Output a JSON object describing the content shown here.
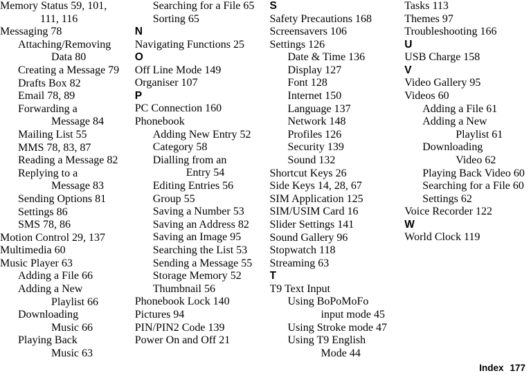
{
  "page": {
    "type": "index",
    "footer": {
      "label": "Index",
      "page_number": "177"
    },
    "text_color": "#000000",
    "background_color": "#ffffff"
  },
  "columns": [
    {
      "id": "column-1",
      "blocks": [
        {
          "kind": "entry",
          "level": 1,
          "text": "Memory Status 59, 101,"
        },
        {
          "kind": "entry",
          "level": 3,
          "text": "111, 116"
        },
        {
          "kind": "entry",
          "level": 1,
          "text": "Messaging 78"
        },
        {
          "kind": "entry",
          "level": 2,
          "text": "Attaching/Removing"
        },
        {
          "kind": "entry",
          "level": 4,
          "text": "Data 80"
        },
        {
          "kind": "entry",
          "level": 2,
          "text": "Creating a Message 79"
        },
        {
          "kind": "entry",
          "level": 2,
          "text": "Drafts Box 82"
        },
        {
          "kind": "entry",
          "level": 2,
          "text": "Email 78, 89"
        },
        {
          "kind": "entry",
          "level": 2,
          "text": "Forwarding a"
        },
        {
          "kind": "entry",
          "level": 4,
          "text": "Message 84"
        },
        {
          "kind": "entry",
          "level": 2,
          "text": "Mailing List 55"
        },
        {
          "kind": "entry",
          "level": 2,
          "text": "MMS 78, 83, 87"
        },
        {
          "kind": "entry",
          "level": 2,
          "text": "Reading a Message 82"
        },
        {
          "kind": "entry",
          "level": 2,
          "text": "Replying to a"
        },
        {
          "kind": "entry",
          "level": 4,
          "text": "Message 83"
        },
        {
          "kind": "entry",
          "level": 2,
          "text": "Sending Options 81"
        },
        {
          "kind": "entry",
          "level": 2,
          "text": "Settings 86"
        },
        {
          "kind": "entry",
          "level": 2,
          "text": "SMS 78, 86"
        },
        {
          "kind": "entry",
          "level": 1,
          "text": "Motion Control 29, 137"
        },
        {
          "kind": "entry",
          "level": 1,
          "text": "Multimedia 60"
        },
        {
          "kind": "entry",
          "level": 1,
          "text": "Music Player 63"
        },
        {
          "kind": "entry",
          "level": 2,
          "text": "Adding a File 66"
        },
        {
          "kind": "entry",
          "level": 2,
          "text": "Adding a New"
        },
        {
          "kind": "entry",
          "level": 4,
          "text": "Playlist 66"
        },
        {
          "kind": "entry",
          "level": 2,
          "text": "Downloading"
        },
        {
          "kind": "entry",
          "level": 4,
          "text": "Music 66"
        },
        {
          "kind": "entry",
          "level": 2,
          "text": "Playing Back"
        },
        {
          "kind": "entry",
          "level": 4,
          "text": "Music 63"
        }
      ]
    },
    {
      "id": "column-2",
      "blocks": [
        {
          "kind": "entry",
          "level": 2,
          "text": "Searching for a File 65"
        },
        {
          "kind": "entry",
          "level": 2,
          "text": "Sorting 65"
        },
        {
          "kind": "letter",
          "text": "N"
        },
        {
          "kind": "entry",
          "level": 1,
          "text": "Navigating Functions 25"
        },
        {
          "kind": "letter",
          "text": "O"
        },
        {
          "kind": "entry",
          "level": 1,
          "text": "Off Line Mode 149"
        },
        {
          "kind": "entry",
          "level": 1,
          "text": "Organiser 107"
        },
        {
          "kind": "letter",
          "text": "P"
        },
        {
          "kind": "entry",
          "level": 1,
          "text": "PC Connection 160"
        },
        {
          "kind": "entry",
          "level": 1,
          "text": "Phonebook"
        },
        {
          "kind": "entry",
          "level": 2,
          "text": "Adding New Entry 52"
        },
        {
          "kind": "entry",
          "level": 2,
          "text": "Category 58"
        },
        {
          "kind": "entry",
          "level": 2,
          "text": "Dialling from an"
        },
        {
          "kind": "entry",
          "level": 4,
          "text": "Entry 54"
        },
        {
          "kind": "entry",
          "level": 2,
          "text": "Editing Entries 56"
        },
        {
          "kind": "entry",
          "level": 2,
          "text": "Group 55"
        },
        {
          "kind": "entry",
          "level": 2,
          "text": "Saving a Number 53"
        },
        {
          "kind": "entry",
          "level": 2,
          "text": "Saving an Address 82"
        },
        {
          "kind": "entry",
          "level": 2,
          "text": "Saving an Image 95"
        },
        {
          "kind": "entry",
          "level": 2,
          "text": "Searching the List 53"
        },
        {
          "kind": "entry",
          "level": 2,
          "text": "Sending a Message 55"
        },
        {
          "kind": "entry",
          "level": 2,
          "text": "Storage Memory 52"
        },
        {
          "kind": "entry",
          "level": 2,
          "text": "Thumbnail 56"
        },
        {
          "kind": "entry",
          "level": 1,
          "text": "Phonebook Lock 140"
        },
        {
          "kind": "entry",
          "level": 1,
          "text": "Pictures 94"
        },
        {
          "kind": "entry",
          "level": 1,
          "text": "PIN/PIN2 Code 139"
        },
        {
          "kind": "entry",
          "level": 1,
          "text": "Power On and Off 21"
        }
      ]
    },
    {
      "id": "column-3",
      "blocks": [
        {
          "kind": "letter",
          "text": "S"
        },
        {
          "kind": "entry",
          "level": 1,
          "text": "Safety Precautions 168"
        },
        {
          "kind": "entry",
          "level": 1,
          "text": "Screensavers 106"
        },
        {
          "kind": "entry",
          "level": 1,
          "text": "Settings 126"
        },
        {
          "kind": "entry",
          "level": 2,
          "text": "Date & Time 136"
        },
        {
          "kind": "entry",
          "level": 2,
          "text": "Display 127"
        },
        {
          "kind": "entry",
          "level": 2,
          "text": "Font 128"
        },
        {
          "kind": "entry",
          "level": 2,
          "text": "Internet 150"
        },
        {
          "kind": "entry",
          "level": 2,
          "text": "Language 137"
        },
        {
          "kind": "entry",
          "level": 2,
          "text": "Network 148"
        },
        {
          "kind": "entry",
          "level": 2,
          "text": "Profiles 126"
        },
        {
          "kind": "entry",
          "level": 2,
          "text": "Security 139"
        },
        {
          "kind": "entry",
          "level": 2,
          "text": "Sound 132"
        },
        {
          "kind": "entry",
          "level": 1,
          "text": "Shortcut Keys 26"
        },
        {
          "kind": "entry",
          "level": 1,
          "text": "Side Keys 14, 28, 67"
        },
        {
          "kind": "entry",
          "level": 1,
          "text": "SIM Application 125"
        },
        {
          "kind": "entry",
          "level": 1,
          "text": "SIM/USIM Card 16"
        },
        {
          "kind": "entry",
          "level": 1,
          "text": "Slider Settings 141"
        },
        {
          "kind": "entry",
          "level": 1,
          "text": "Sound Gallery 96"
        },
        {
          "kind": "entry",
          "level": 1,
          "text": "Stopwatch 118"
        },
        {
          "kind": "entry",
          "level": 1,
          "text": "Streaming 63"
        },
        {
          "kind": "letter",
          "text": "T"
        },
        {
          "kind": "entry",
          "level": 1,
          "text": "T9 Text Input"
        },
        {
          "kind": "entry",
          "level": 2,
          "text": "Using BoPoMoFo"
        },
        {
          "kind": "entry",
          "level": 4,
          "text": "input mode 45"
        },
        {
          "kind": "entry",
          "level": 2,
          "text": "Using Stroke mode 47"
        },
        {
          "kind": "entry",
          "level": 2,
          "text": "Using T9 English"
        },
        {
          "kind": "entry",
          "level": 4,
          "text": "Mode 44"
        }
      ]
    },
    {
      "id": "column-4",
      "blocks": [
        {
          "kind": "entry",
          "level": 1,
          "text": "Tasks 113"
        },
        {
          "kind": "entry",
          "level": 1,
          "text": "Themes 97"
        },
        {
          "kind": "entry",
          "level": 1,
          "text": "Troubleshooting 166"
        },
        {
          "kind": "letter",
          "text": "U"
        },
        {
          "kind": "entry",
          "level": 1,
          "text": "USB Charge 158"
        },
        {
          "kind": "letter",
          "text": "V"
        },
        {
          "kind": "entry",
          "level": 1,
          "text": "Video Gallery 95"
        },
        {
          "kind": "entry",
          "level": 1,
          "text": "Videos 60"
        },
        {
          "kind": "entry",
          "level": 2,
          "text": "Adding a File 61"
        },
        {
          "kind": "entry",
          "level": 2,
          "text": "Adding a New"
        },
        {
          "kind": "entry",
          "level": 4,
          "text": "Playlist 61"
        },
        {
          "kind": "entry",
          "level": 2,
          "text": "Downloading"
        },
        {
          "kind": "entry",
          "level": 4,
          "text": "Video 62"
        },
        {
          "kind": "entry",
          "level": 2,
          "text": "Playing Back Video 60"
        },
        {
          "kind": "entry",
          "level": 2,
          "text": "Searching for a File 60"
        },
        {
          "kind": "entry",
          "level": 2,
          "text": "Settings 62"
        },
        {
          "kind": "entry",
          "level": 1,
          "text": "Voice Recorder 122"
        },
        {
          "kind": "letter",
          "text": "W"
        },
        {
          "kind": "entry",
          "level": 1,
          "text": "World Clock 119"
        }
      ]
    }
  ]
}
